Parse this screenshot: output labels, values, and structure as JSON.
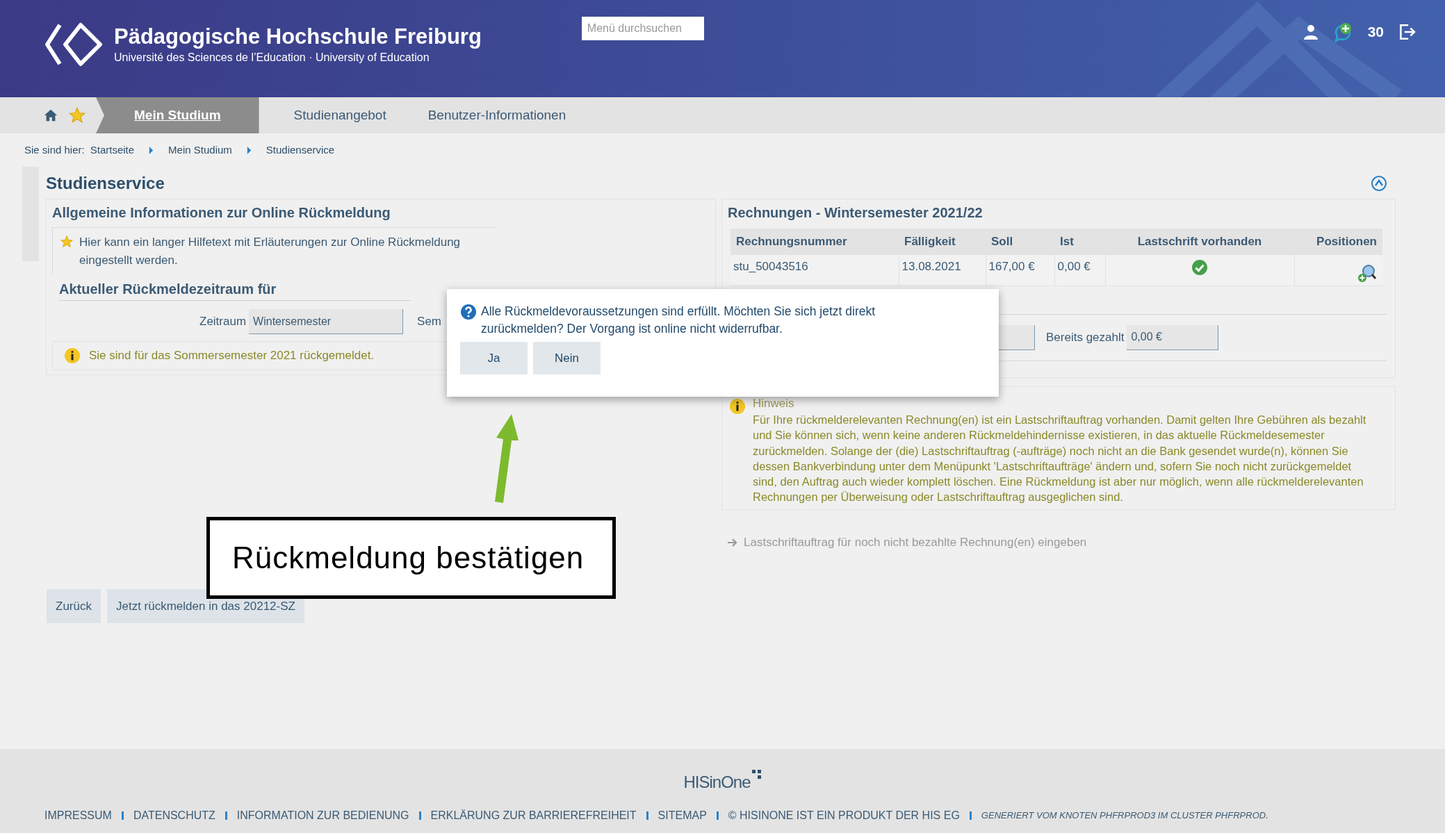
{
  "header": {
    "title": "Pädagogische Hochschule Freiburg",
    "subtitle": "Université des Sciences de l’Education · University of Education",
    "search": {
      "placeholder": "Menü durchsuchen"
    },
    "counter": "30"
  },
  "nav": {
    "tabs": [
      {
        "label": "Mein Studium",
        "selected": true
      },
      {
        "label": "Studienangebot",
        "selected": false
      },
      {
        "label": "Benutzer-Informationen",
        "selected": false
      }
    ]
  },
  "breadcrumb": {
    "label": "Sie sind hier:",
    "items": [
      "Startseite",
      "Mein Studium",
      "Studienservice"
    ]
  },
  "page_title": "Studienservice",
  "info_panel": {
    "title": "Allgemeine Informationen zur Online Rückmeldung",
    "help_text": "Hier kann ein langer Hilfetext mit Erläuterungen zur Online Rückmeldung eingestellt werden.",
    "period_heading": "Aktueller Rückmeldezeitraum für",
    "fields": [
      {
        "label": "Zeitraum",
        "value": "Wintersemester"
      },
      {
        "label": "Sem"
      }
    ],
    "notice": "Sie sind für das Sommersemester 2021 rückgemeldet."
  },
  "invoices": {
    "title": "Rechnungen - Wintersemester 2021/22",
    "columns": [
      "Rechnungsnummer",
      "Fälligkeit",
      "Soll",
      "Ist",
      "Lastschrift vorhanden",
      "Positionen"
    ],
    "rows": [
      {
        "cells": [
          "stu_50043516",
          "13.08.2021",
          "167,00 €",
          "0,00 €"
        ],
        "debit": true
      }
    ],
    "paid_label": "Bereits gezahlt",
    "paid_value": "0,00 €",
    "hint_title": "Hinweis",
    "hint_text": "Für Ihre rückmelderelevanten Rechnung(en) ist ein Lastschriftauftrag vorhanden. Damit gelten Ihre Gebühren als bezahlt und Sie können sich, wenn keine anderen Rückmeldehindernisse existieren, in das aktuelle Rückmeldesemester zurückmelden. Solange der (die) Lastschriftauftrag (-aufträge) noch nicht an die Bank gesendet wurde(n), können Sie dessen Bankverbindung unter dem Menüpunkt 'Lastschriftaufträge' ändern und, sofern Sie noch nicht zurückgemeldet sind, den Auftrag auch wieder komplett löschen. Eine Rückmeldung ist aber nur möglich, wenn alle rückmelderelevanten Rechnungen per Überweisung oder Lastschriftauftrag ausgeglichen sind.",
    "link": "Lastschriftauftrag für noch nicht bezahlte Rechnung(en) eingeben"
  },
  "buttons": [
    "Zurück",
    "Jetzt rückmelden in das 20212-SZ"
  ],
  "dialog": {
    "message": "Alle Rückmeldevoraussetzungen sind erfüllt. Möchten Sie sich jetzt direkt zurückmelden? Der Vorgang ist online nicht widerrufbar.",
    "buttons": [
      "Ja",
      "Nein"
    ]
  },
  "annotation": {
    "callout": "Rückmeldung bestätigen"
  },
  "footer": {
    "logo": "HISinOne",
    "links": [
      "IMPRESSUM",
      "DATENSCHUTZ",
      "INFORMATION ZUR BEDIENUNG",
      "ERKLÄRUNG ZUR BARRIEREFREIHEIT",
      "SITEMAP",
      "© HISINONE IST EIN PRODUKT DER HIS EG"
    ],
    "generated": "GENERIERT VOM KNOTEN PHFRPROD3 IM CLUSTER PHFRPROD."
  }
}
